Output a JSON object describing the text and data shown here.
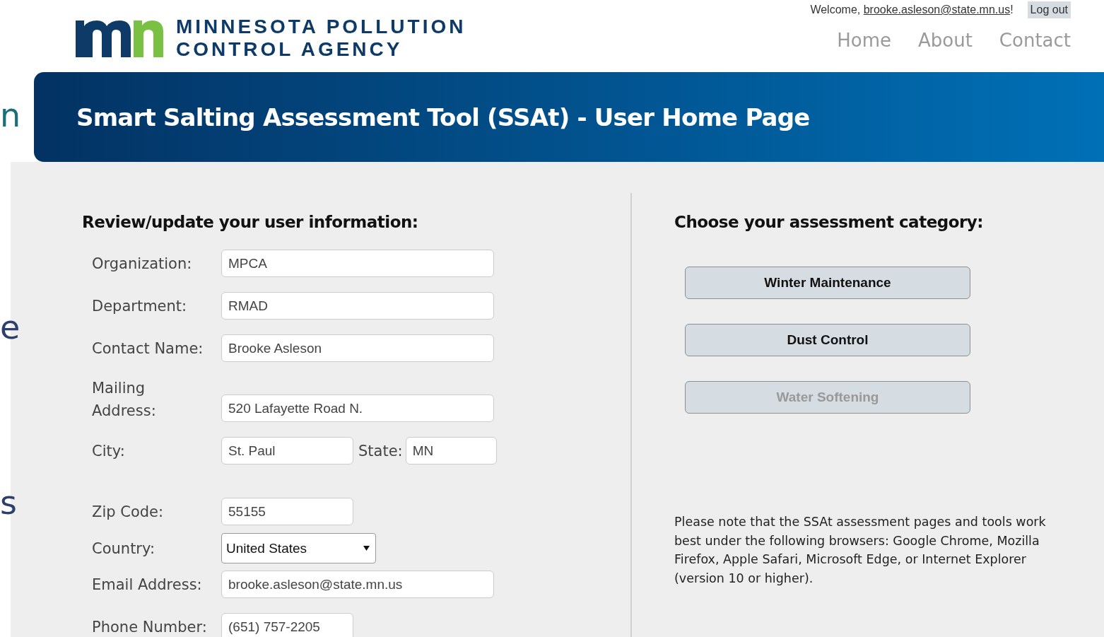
{
  "edge_fragments": [
    {
      "text": "n",
      "color": "#1b6f7a"
    },
    {
      "text": "e",
      "color": "#2e3f6e"
    },
    {
      "text": "s",
      "color": "#2e3f6e"
    }
  ],
  "header": {
    "logo_lines": [
      "MINNESOTA POLLUTION",
      "CONTROL AGENCY"
    ],
    "welcome": "Welcome, ",
    "user_email": "brooke.asleson@state.mn.us",
    "welcome_end": "!",
    "logout": "Log out",
    "nav": [
      {
        "label": "Home"
      },
      {
        "label": "About"
      },
      {
        "label": "Contact"
      }
    ]
  },
  "banner": {
    "title": "Smart Salting Assessment Tool (SSAt) - User Home Page"
  },
  "user_info": {
    "heading": "Review/update your user information:",
    "rows": [
      {
        "kind": "text",
        "label": "Organization:",
        "value": "MPCA"
      },
      {
        "kind": "text",
        "label": "Department:",
        "value": "RMAD"
      },
      {
        "kind": "text",
        "label": "Contact Name:",
        "value": "Brooke Asleson"
      },
      {
        "kind": "address",
        "label": "Mailing Address:",
        "value": "520 Lafayette Road N."
      },
      {
        "kind": "pair",
        "label": "City:",
        "value": "St. Paul",
        "label2": "State:",
        "value2": "MN"
      },
      {
        "kind": "short",
        "label": "Zip Code:",
        "value": "55155"
      },
      {
        "kind": "select",
        "label": "Country:",
        "value": "United States"
      },
      {
        "kind": "text",
        "label": "Email Address:",
        "value": "brooke.asleson@state.mn.us"
      },
      {
        "kind": "short",
        "label": "Phone Number:",
        "value": "(651) 757-2205"
      }
    ]
  },
  "assessment": {
    "heading": "Choose your assessment category:",
    "buttons": [
      {
        "label": "Winter Maintenance",
        "disabled": false
      },
      {
        "label": "Dust Control",
        "disabled": false
      },
      {
        "label": "Water Softening",
        "disabled": true
      }
    ],
    "note": "Please note that the SSAt assessment pages and tools work best under the following browsers: Google Chrome, Mozilla Firefox, Apple Safari, Microsoft Edge, or Internet Explorer (version 10 or higher)."
  }
}
